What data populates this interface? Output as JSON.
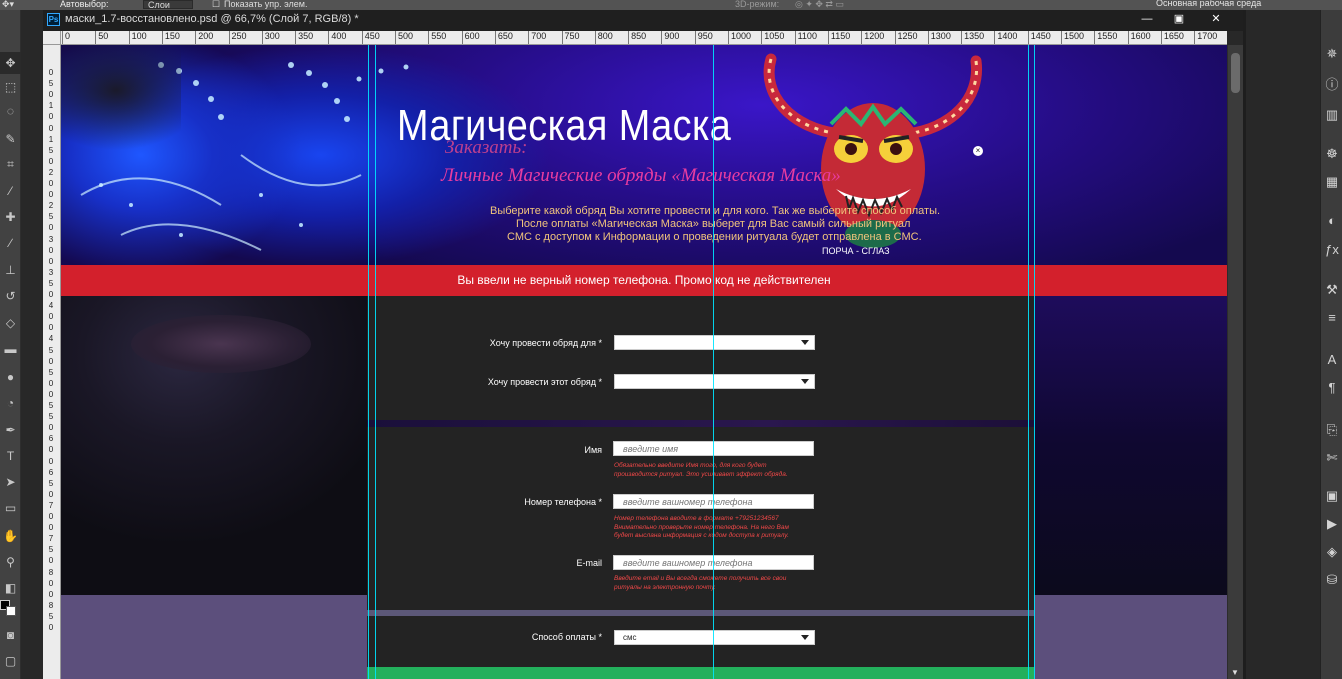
{
  "options_bar": {
    "autoselect_label": "Автовыбор:",
    "autoselect_value": "Слои",
    "show_transform_label": "Показать упр. элем.",
    "mode_3d_label": "3D-режим:",
    "workspace": "Основная рабочая среда"
  },
  "document": {
    "tab_title": "маски_1.7-восстановлено.psd @ 66,7% (Слой 7, RGB/8) *",
    "app_badge": "Ps"
  },
  "ruler_top_ticks": [
    "0",
    "50",
    "100",
    "150",
    "200",
    "250",
    "300",
    "350",
    "400",
    "450",
    "500",
    "550",
    "600",
    "650",
    "700",
    "750",
    "800",
    "850",
    "900",
    "950",
    "1000",
    "1050",
    "1100",
    "1150",
    "1200",
    "1250",
    "1300",
    "1350",
    "1400",
    "1450",
    "1500",
    "1550",
    "1600",
    "1650",
    "1700"
  ],
  "ruler_left_ticks": [
    "0",
    "5",
    "0",
    "1",
    "0",
    "0",
    "1",
    "5",
    "0",
    "2",
    "0",
    "0",
    "2",
    "5",
    "0",
    "3",
    "0",
    "0",
    "3",
    "5",
    "0",
    "4",
    "0",
    "0",
    "4",
    "5",
    "0",
    "5",
    "0",
    "0",
    "5",
    "5",
    "0",
    "6",
    "0",
    "0",
    "6",
    "5",
    "0",
    "7",
    "0",
    "0",
    "7",
    "5",
    "0",
    "8",
    "0",
    "0",
    "8",
    "5",
    "0"
  ],
  "site": {
    "title": "Магическая Маска",
    "order_label": "Заказать:",
    "subtitle_script": "Личные Магические обряды «Магическая Маска»",
    "intro_lines": [
      "Выберите какой обряд Вы хотите провести и для кого. Так же выберите способ оплаты.",
      "После оплаты «Магическая Маска» выберет для Вас самый сильный ритуал",
      "СМС с доступом к Информации о проведении ритуала будет отправлена в СМС."
    ],
    "category": "ПОРЧА - СГЛАЗ",
    "close_glyph": "×"
  },
  "error_message": "Вы ввели не верный номер телефона. Промо код не действителен",
  "form": {
    "for_whom_label": "Хочу провести обряд для *",
    "for_whom_value": "",
    "ritual_label": "Хочу провести этот обряд *",
    "ritual_value": "",
    "name_label": "Имя",
    "name_placeholder": "введите имя",
    "name_hint": [
      "Обязательно введите Имя того, для кого будет",
      "производится ритуал. Это усиливает эффект обряда."
    ],
    "phone_label": "Номер телефона *",
    "phone_placeholder": "введите вашномер телефона",
    "phone_hint": [
      "Номер телефона вводите в формате +79251234567",
      "Внимательно проверьте номер телефона. На него Вам",
      "будет выслана  информация с кодом доступа к ритуалу."
    ],
    "email_label": "E-mail",
    "email_placeholder": "введите вашномер телефона",
    "email_hint": [
      "Введите email и Вы всегда сможете получить все свои",
      "ритуалы на электронную почту."
    ],
    "payment_label": "Способ оплаты *",
    "payment_value": "смс"
  },
  "tools": [
    "move-tool",
    "marquee-tool",
    "lasso-tool",
    "quick-select-tool",
    "crop-tool",
    "eyedropper-tool",
    "healing-brush-tool",
    "brush-tool",
    "clone-stamp-tool",
    "history-brush-tool",
    "eraser-tool",
    "gradient-tool",
    "blur-tool",
    "dodge-tool",
    "pen-tool",
    "type-tool",
    "path-select-tool",
    "rectangle-tool",
    "hand-tool",
    "zoom-tool"
  ],
  "panel_icons": [
    "navigator-icon",
    "info-icon",
    "histogram-icon",
    "color-icon",
    "swatches-icon",
    "adjustments-icon",
    "styles-icon",
    "brush-icon",
    "brush-presets-icon",
    "character-icon",
    "paragraph-icon",
    "clone-source-icon",
    "tool-presets-icon",
    "layers-icon",
    "channels-icon",
    "paths-icon"
  ]
}
